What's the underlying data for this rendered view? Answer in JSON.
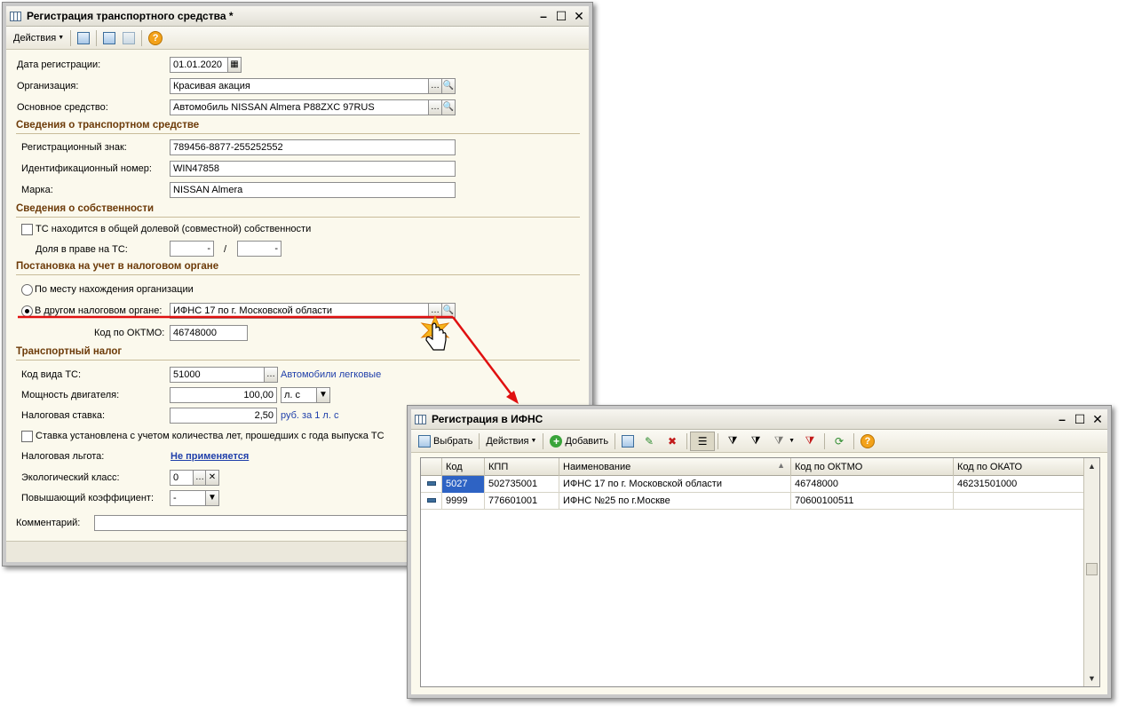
{
  "main_window": {
    "title": "Регистрация транспортного средства *",
    "toolbar": {
      "actions_label": "Действия"
    },
    "fields": {
      "reg_date_label": "Дата регистрации:",
      "reg_date_value": "01.01.2020",
      "org_label": "Организация:",
      "org_value": "Красивая акация",
      "asset_label": "Основное средство:",
      "asset_value": "Автомобиль NISSAN Almera P88ZXC 97RUS"
    },
    "section_vehicle": {
      "title": "Сведения о транспортном средстве",
      "reg_sign_label": "Регистрационный знак:",
      "reg_sign_value": "789456-8877-255252552",
      "vin_label": "Идентификационный номер:",
      "vin_value": "WIN47858",
      "brand_label": "Марка:",
      "brand_value": "NISSAN Almera"
    },
    "section_ownership": {
      "title": "Сведения о собственности",
      "shared_label": "ТС находится в общей долевой (совместной) собственности",
      "share_label": "Доля в праве на ТС:",
      "share_sep": "/",
      "share_num": "-",
      "share_den": "-"
    },
    "section_tax_office": {
      "title": "Постановка на учет в налоговом органе",
      "option_org_label": "По месту нахождения организации",
      "option_other_label": "В другом налоговом органе:",
      "other_value": "ИФНС 17 по г. Московской области",
      "oktmo_label": "Код по ОКТМО:",
      "oktmo_value": "46748000"
    },
    "section_tax": {
      "title": "Транспортный налог",
      "kind_label": "Код вида ТС:",
      "kind_value": "51000",
      "kind_desc": "Автомобили легковые",
      "power_label": "Мощность двигателя:",
      "power_value": "100,00",
      "power_unit": "л. с",
      "rate_label": "Налоговая ставка:",
      "rate_value": "2,50",
      "rate_desc": "руб. за 1 л. с",
      "years_label": "Ставка установлена с учетом количества лет, прошедших с года выпуска ТС",
      "benefit_label": "Налоговая льгота:",
      "benefit_value": "Не применяется",
      "eco_label": "Экологический класс:",
      "eco_value": "0",
      "coef_label": "Повышающий коэффициент:",
      "coef_value": "-",
      "comment_label": "Комментарий:",
      "comment_value": ""
    }
  },
  "dialog": {
    "title": "Регистрация в ИФНС",
    "toolbar": {
      "select_label": "Выбрать",
      "actions_label": "Действия",
      "add_label": "Добавить"
    },
    "table": {
      "columns": [
        "Код",
        "КПП",
        "Наименование",
        "Код по ОКТМО",
        "Код по ОКАТО"
      ],
      "rows": [
        [
          "5027",
          "502735001",
          "ИФНС 17 по г. Московской области",
          "46748000",
          "46231501000"
        ],
        [
          "9999",
          "776601001",
          "ИФНС №25 по г.Москве",
          "70600100511",
          ""
        ]
      ]
    }
  },
  "colors": {
    "section_title": "#6d3b09",
    "link": "#1f3faa",
    "selection": "#2e63c4",
    "arrow": "#e01010",
    "window_bg": "#fbf9ed"
  }
}
